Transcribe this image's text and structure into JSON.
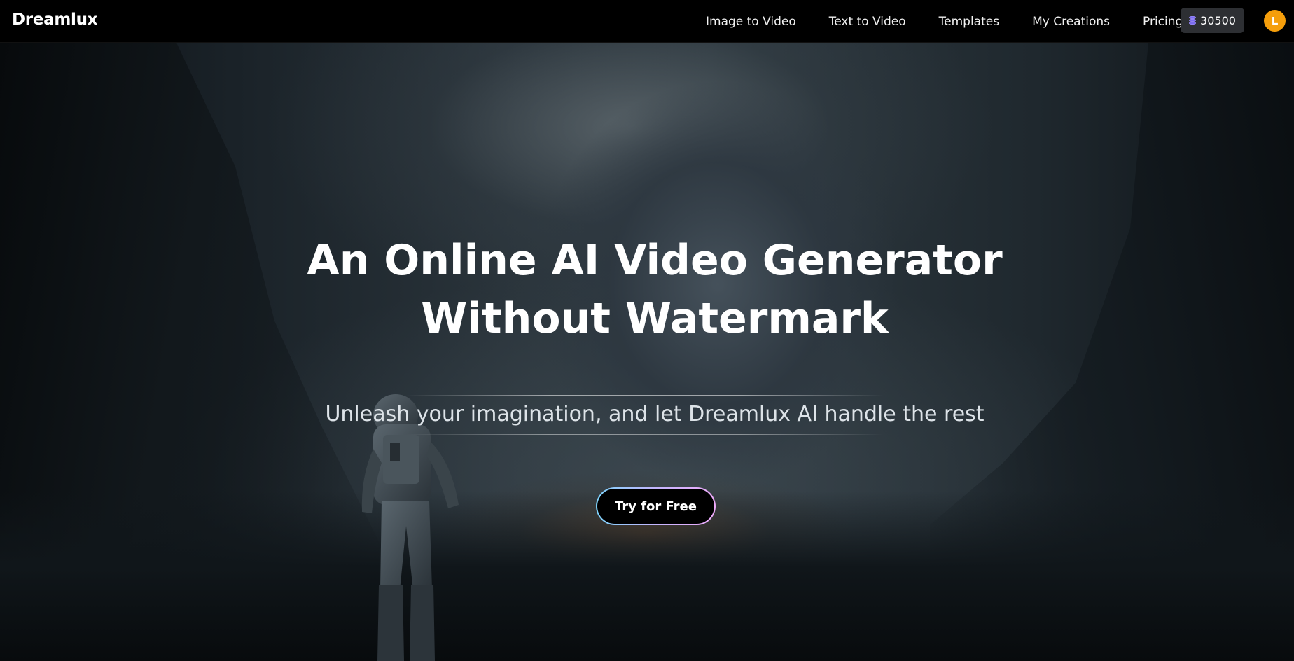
{
  "brand": {
    "name": "Dreamlux"
  },
  "nav": {
    "items": [
      {
        "label": "Image to Video"
      },
      {
        "label": "Text to Video"
      },
      {
        "label": "Templates"
      },
      {
        "label": "My Creations"
      },
      {
        "label": "Pricing"
      }
    ],
    "credits": {
      "value": "30500",
      "icon": "coin-stack-icon"
    },
    "avatar": {
      "initial": "L",
      "color": "#f59e0b"
    }
  },
  "hero": {
    "title_line1": "An Online AI Video Generator",
    "title_line2": "Without Watermark",
    "subtitle": "Unleash your imagination, and let Dreamlux AI handle the rest",
    "cta_label": "Try for Free"
  }
}
